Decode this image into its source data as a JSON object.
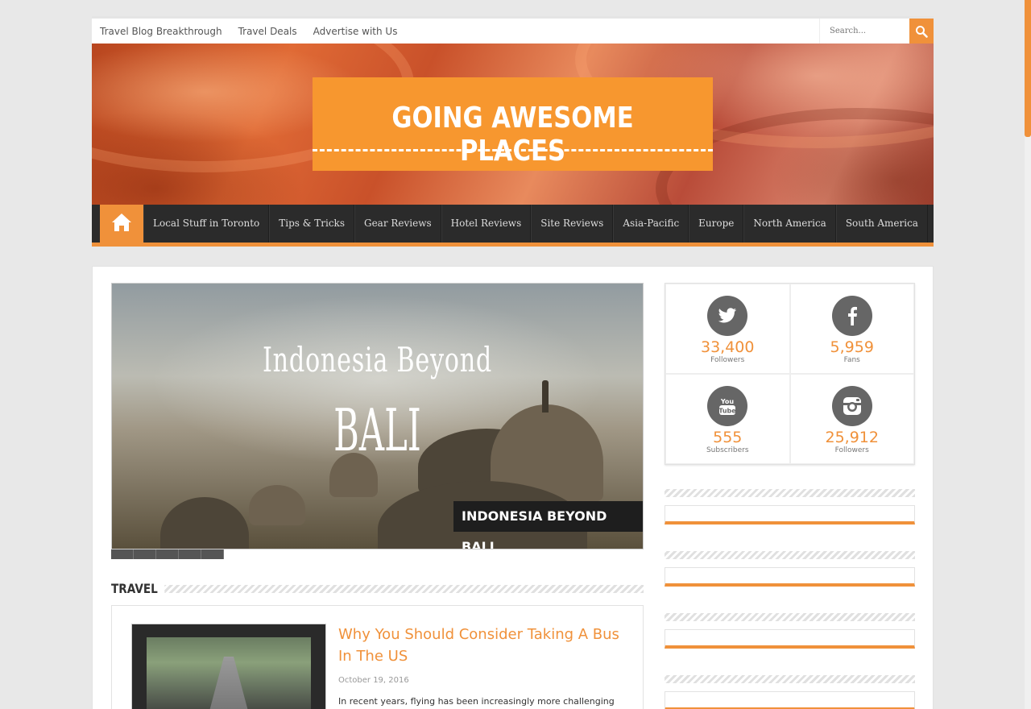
{
  "topbar": {
    "links": [
      "Travel Blog Breakthrough",
      "Travel Deals",
      "Advertise with Us"
    ],
    "search_placeholder": "Search..."
  },
  "header": {
    "logo_text": "GOING AWESOME PLACES"
  },
  "nav": {
    "items": [
      "Local Stuff in Toronto",
      "Tips & Tricks",
      "Gear Reviews",
      "Hotel Reviews",
      "Site Reviews",
      "Asia-Pacific",
      "Europe",
      "North America",
      "South America"
    ]
  },
  "slider": {
    "overlay_line1": "Indonesia Beyond",
    "overlay_line2": "BALI",
    "caption": "INDONESIA BEYOND BALI",
    "dot_count": 5
  },
  "section": {
    "heading": "TRAVEL"
  },
  "article": {
    "title": "Why You Should Consider Taking A Bus In The US",
    "date": "October 19, 2016",
    "excerpt": "In recent years, flying has been increasingly more challenging"
  },
  "social": [
    {
      "icon": "twitter-icon",
      "count": "33,400",
      "label": "Followers"
    },
    {
      "icon": "facebook-icon",
      "count": "5,959",
      "label": "Fans"
    },
    {
      "icon": "youtube-icon",
      "count": "555",
      "label": "Subscribers"
    },
    {
      "icon": "instagram-icon",
      "count": "25,912",
      "label": "Followers"
    }
  ],
  "colors": {
    "accent": "#f0913a",
    "nav_bg": "#2b2b2b",
    "logo_bg": "#f7972f"
  }
}
